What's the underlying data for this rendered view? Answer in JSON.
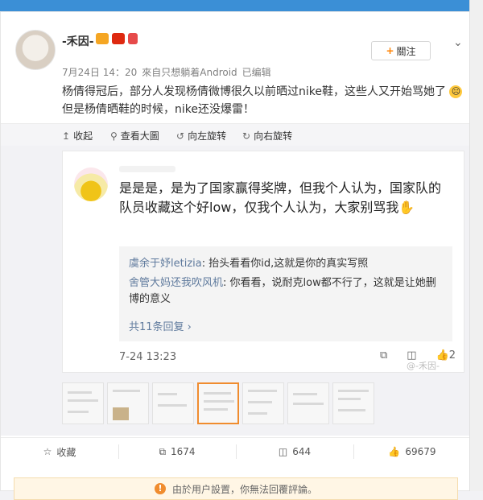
{
  "post": {
    "username": "-禾因-",
    "follow_label": "關注",
    "date": "7月24日 14：20",
    "source": "來自只想躺着Android",
    "edited": "已编辑",
    "text_line1": "杨倩得冠后，部分人发现杨倩微博很久以前晒过nike鞋，这些人又开始骂她了",
    "text_line2": "但是杨倩晒鞋的时候，nike还没爆雷！"
  },
  "media_toolbar": {
    "collapse": "收起",
    "view_large": "查看大圖",
    "rotate_left": "向左旋转",
    "rotate_right": "向右旋转"
  },
  "screenshot": {
    "comment": "是是是，是为了国家赢得奖牌，但我个人认为，国家队的队员收藏这个好low，仅我个人认为，大家别骂我",
    "replies": [
      {
        "author": "虞余于妤letizia",
        "text": ": 抬头看看你id,这就是你的真实写照"
      },
      {
        "author": "舍管大妈还我吹风机",
        "text": ": 你看看，说耐克low都不行了，这就是让她删博的意义"
      }
    ],
    "more_replies": "共11条回复 ›",
    "date": "7-24 13:23",
    "likes": "2",
    "watermark": "@-禾因-"
  },
  "actions": {
    "favorite": "收藏",
    "reposts": "1674",
    "comments": "644",
    "likes": "69679"
  },
  "notice": "由於用户設置，你無法回覆評論。",
  "colors": {
    "accent_orange": "#ff8200",
    "link_blue": "#5f7a9d",
    "thumb_active": "#f08c2e"
  }
}
